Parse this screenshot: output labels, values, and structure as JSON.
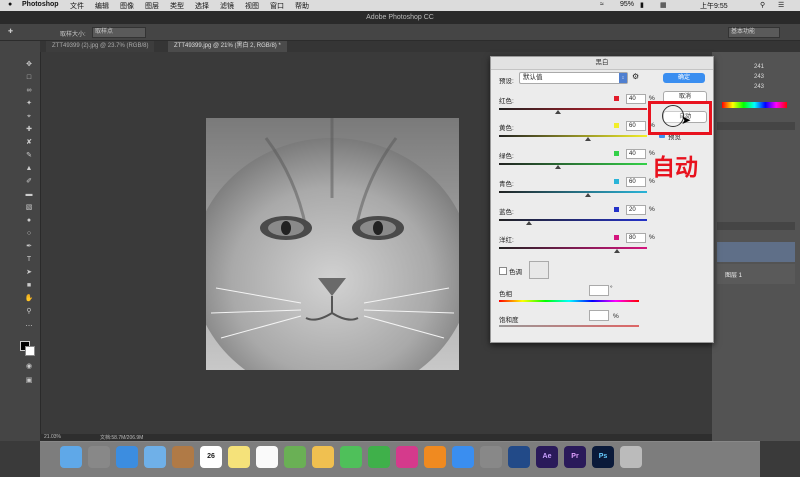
{
  "menubar": {
    "apple": "",
    "app_name": "Photoshop",
    "menus": [
      "文件",
      "编辑",
      "图像",
      "图层",
      "类型",
      "选择",
      "滤镜",
      "视图",
      "窗口",
      "帮助"
    ],
    "battery": "95%",
    "clock": "上午9:55"
  },
  "window_title": "Adobe Photoshop CC",
  "options": {
    "label": "取样大小:",
    "value": "取样点",
    "workspace": "基本功能"
  },
  "tabs": [
    {
      "label": "ZTT49399 (2).jpg @ 23.7% (RGB/8)"
    },
    {
      "label": "ZTT49399.jpg @ 21% (黑白 2, RGB/8) *"
    }
  ],
  "rgb_values": [
    "241",
    "243",
    "243"
  ],
  "layers": {
    "layer_name": "图层 1"
  },
  "dialog": {
    "title": "黑白",
    "preset_label": "预设:",
    "preset_value": "默认值",
    "ok": "确定",
    "cancel": "取消",
    "auto": "自动",
    "preview": "预览",
    "sliders": [
      {
        "label": "红色:",
        "value": "40",
        "color": "#e21b2a",
        "pos": 40
      },
      {
        "label": "黄色:",
        "value": "60",
        "color": "#f2ee2a",
        "pos": 60
      },
      {
        "label": "绿色:",
        "value": "40",
        "color": "#33d148",
        "pos": 40
      },
      {
        "label": "青色:",
        "value": "60",
        "color": "#2ab4d8",
        "pos": 60
      },
      {
        "label": "蓝色:",
        "value": "20",
        "color": "#2432c8",
        "pos": 20
      },
      {
        "label": "洋红:",
        "value": "80",
        "color": "#d4157e",
        "pos": 80
      }
    ],
    "tint_label": "色调",
    "hue_label": "色相",
    "hue_unit": "°",
    "saturation_label": "饱和度",
    "saturation_unit": "%",
    "percent": "%"
  },
  "annotation": {
    "text": "自动",
    "color": "#e8121e"
  },
  "statusbar": {
    "zoom": "21.03%",
    "doc": "文档:58.7M/206.9M"
  },
  "dock": {
    "apps": [
      "Finder",
      "Launchpad",
      "Safari",
      "Mail",
      "Contacts",
      "Calendar",
      "Notes",
      "Reminders",
      "Maps",
      "Photos",
      "Messages",
      "FaceTime",
      "iTunes",
      "iBooks",
      "App Store",
      "System Preferences",
      "QuickTime",
      "Ae",
      "Pr",
      "Ps",
      "Trash"
    ],
    "calendar_day": "26"
  }
}
